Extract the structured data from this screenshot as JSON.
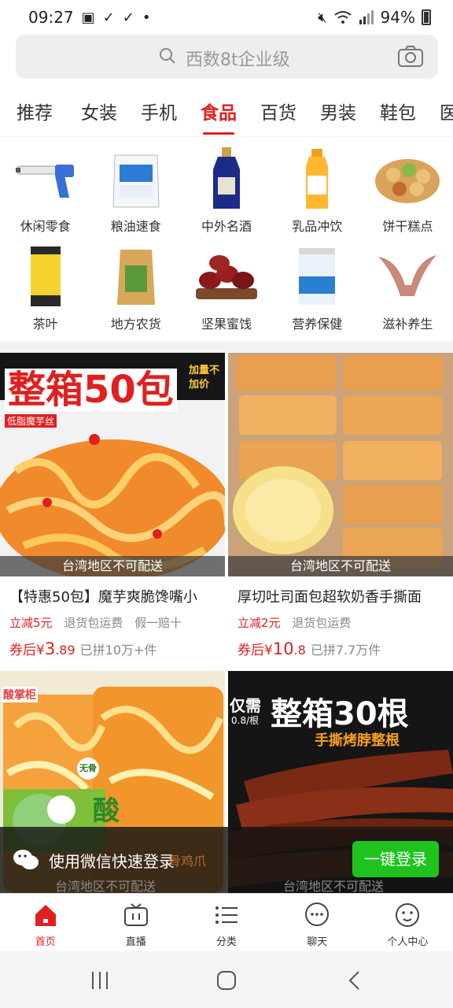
{
  "status_bar": {
    "time": "09:27",
    "battery": "94%"
  },
  "search": {
    "placeholder": "西数8t企业级"
  },
  "tabs": [
    {
      "label": "推荐"
    },
    {
      "label": "女装"
    },
    {
      "label": "手机"
    },
    {
      "label": "食品",
      "active": true
    },
    {
      "label": "百货"
    },
    {
      "label": "男装"
    },
    {
      "label": "鞋包"
    },
    {
      "label": "医药"
    }
  ],
  "categories": [
    {
      "label": "休闲零食",
      "icon": "toy-gun-icon"
    },
    {
      "label": "粮油速食",
      "icon": "flour-bag-icon"
    },
    {
      "label": "中外名酒",
      "icon": "liquor-bottle-icon"
    },
    {
      "label": "乳品冲饮",
      "icon": "juice-bottle-icon"
    },
    {
      "label": "饼干糕点",
      "icon": "pastry-tray-icon"
    },
    {
      "label": "茶叶",
      "icon": "tea-can-icon"
    },
    {
      "label": "地方农货",
      "icon": "tea-bag-icon"
    },
    {
      "label": "坚果蜜饯",
      "icon": "dates-icon"
    },
    {
      "label": "营养保健",
      "icon": "milk-powder-can-icon"
    },
    {
      "label": "滋补养生",
      "icon": "deer-antler-icon"
    }
  ],
  "products": [
    {
      "image_text": "整箱50包",
      "image_side_text": "加量不加价",
      "image_sub_text": "低脂魔芋丝",
      "delivery_note": "台湾地区不可配送",
      "title": "【特惠50包】魔芋爽脆馋嘴小",
      "tags": [
        "立减5元",
        "退货包运费",
        "假一赔十"
      ],
      "price_label": "券后",
      "currency": "¥",
      "price_int": "3",
      "price_dec": ".89",
      "sold": "已拼10万+件"
    },
    {
      "delivery_note": "台湾地区不可配送",
      "title": "厚切吐司面包超软奶香手撕面",
      "tags": [
        "立减2元",
        "退货包运费"
      ],
      "price_label": "券后",
      "currency": "¥",
      "price_int": "10",
      "price_dec": ".8",
      "sold": "已拼7.7万件"
    },
    {
      "brand_text": "酸掌柜",
      "badge_text": "无骨",
      "image_text": "酸",
      "overlay_text": "骨鸡爪",
      "delivery_note": "台湾地区不可配送"
    },
    {
      "side_text": "仅需",
      "side_sub": "0.8/根",
      "image_text": "整箱30根",
      "image_sub_text": "手撕烤脖整根",
      "delivery_note": "台湾地区不可配送"
    }
  ],
  "login_banner": {
    "text": "使用微信快速登录",
    "button": "一键登录"
  },
  "bottom_nav": [
    {
      "label": "首页",
      "icon": "home-icon",
      "active": true
    },
    {
      "label": "直播",
      "icon": "tv-icon"
    },
    {
      "label": "分类",
      "icon": "list-icon"
    },
    {
      "label": "聊天",
      "icon": "chat-icon"
    },
    {
      "label": "个人中心",
      "icon": "profile-icon"
    }
  ],
  "colors": {
    "accent": "#e02020",
    "wechat_green": "#1ec31e"
  }
}
